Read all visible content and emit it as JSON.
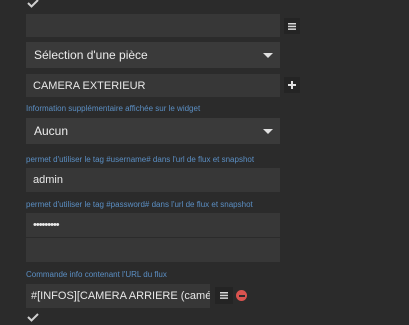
{
  "room_select": {
    "selected": "Sélection d'une pièce"
  },
  "equipment_field": {
    "value": "CAMERA EXTERIEUR"
  },
  "widget_info": {
    "help": "Information supplémentaire affichée sur le widget",
    "selected": "Aucun"
  },
  "username": {
    "help": "permet d'utiliser le tag #username# dans l'url de flux et snapshot",
    "value": "admin"
  },
  "password": {
    "help": "permet d'utiliser le tag #password# dans l'url de flux et snapshot",
    "value": "•••••••••"
  },
  "stream_command": {
    "help": "Commande info contenant l'URL du flux",
    "value": "#[INFOS][CAMERA ARRIERE (caméra)][Flux"
  },
  "icons": {
    "checkbox": "checkmark-icon",
    "list": "list-icon",
    "add": "plus-icon",
    "remove": "minus-circle-icon"
  },
  "colors": {
    "background": "#2b2b2b",
    "field": "#373737",
    "help_text": "#5b8fc4",
    "remove": "#d9534f"
  }
}
